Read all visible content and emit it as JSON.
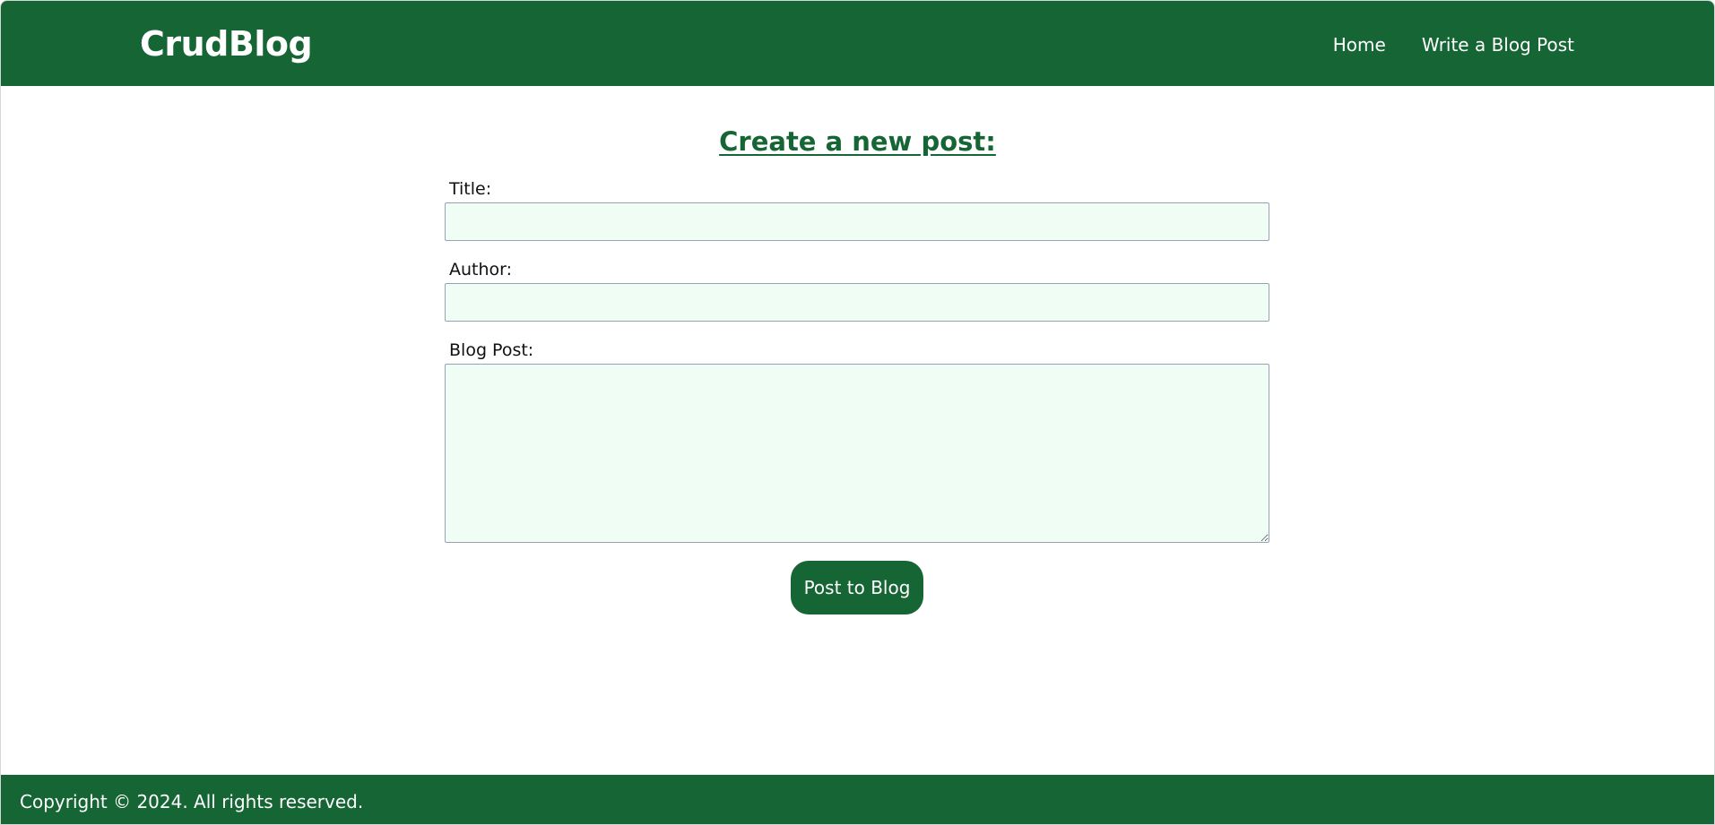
{
  "header": {
    "brand": "CrudBlog",
    "nav": [
      {
        "label": "Home"
      },
      {
        "label": "Write a Blog Post"
      }
    ]
  },
  "form": {
    "heading": "Create a new post:",
    "title_label": "Title:",
    "title_value": "",
    "author_label": "Author:",
    "author_value": "",
    "post_label": "Blog Post:",
    "post_value": "",
    "submit_label": "Post to Blog"
  },
  "footer": {
    "copyright": "Copyright © 2024. All rights reserved."
  },
  "colors": {
    "brand_green": "#166534",
    "input_background": "#f0fdf4",
    "text_on_brand": "#ffffff"
  }
}
